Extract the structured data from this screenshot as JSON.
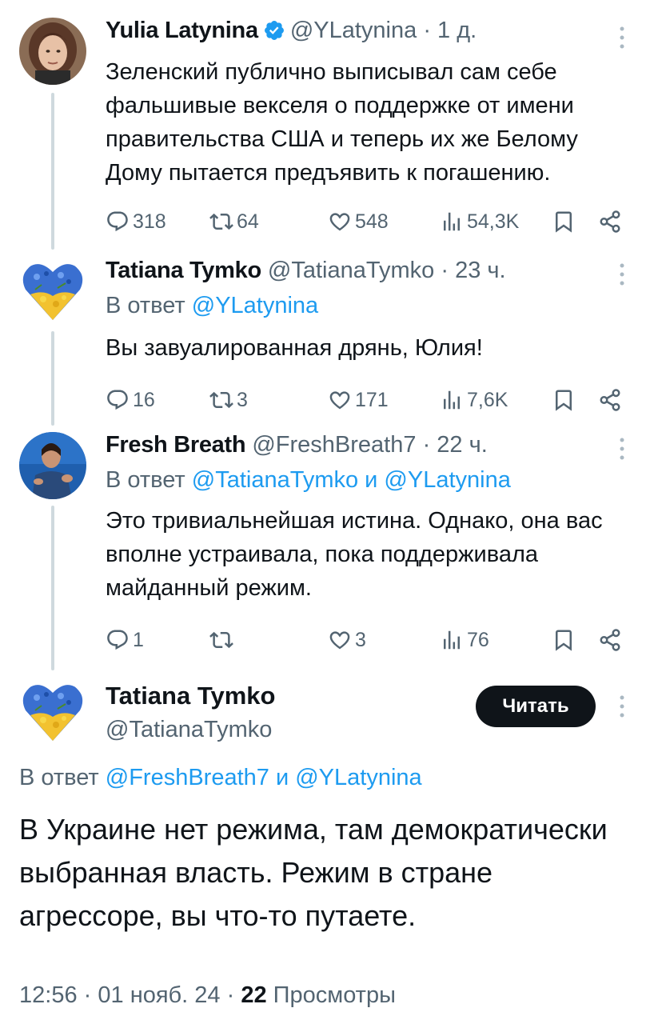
{
  "tweets": [
    {
      "name": "Yulia Latynina",
      "handle": "@YLatynina",
      "time": "1 д.",
      "text": "Зеленский публично выписывал сам себе фальшивые векселя о поддержке от имени правительства США и  теперь их же Белому Дому пытается предъявить к погашению.",
      "replies": "318",
      "retweets": "64",
      "likes": "548",
      "views": "54,3K"
    },
    {
      "name": "Tatiana Tymko",
      "handle": "@TatianaTymko",
      "time": "23 ч.",
      "reply_prefix": "В ответ",
      "reply_mentions": "@YLatynina",
      "text": "Вы завуалированная дрянь, Юлия!",
      "replies": "16",
      "retweets": "3",
      "likes": "171",
      "views": "7,6K"
    },
    {
      "name": "Fresh Breath",
      "handle": "@FreshBreath7",
      "time": "22 ч.",
      "reply_prefix": "В ответ",
      "reply_mentions": "@TatianaTymko и @YLatynina",
      "text": "Это тривиальнейшая истина. Однако, она вас вполне устраивала, пока поддерживала майданный режим.",
      "replies": "1",
      "retweets": "",
      "likes": "3",
      "views": "76"
    }
  ],
  "main": {
    "name": "Tatiana Tymko",
    "handle": "@TatianaTymko",
    "follow_label": "Читать",
    "reply_prefix": "В ответ",
    "reply_mentions": "@FreshBreath7 и @YLatynina",
    "text": "В Украине нет режима, там демократически выбранная власть. Режим в стране агрессоре, вы что-то путаете.",
    "time": "12:56",
    "date": "01 нояб. 24",
    "views_count": "22",
    "views_label": "Просмотры"
  },
  "dot": "·",
  "colors": {
    "link": "#1d9bf0",
    "secondary": "#536471",
    "thread_line": "#cfd9de",
    "verified": "#1d9bf0"
  },
  "icons": [
    "reply-icon",
    "retweet-icon",
    "like-icon",
    "views-icon",
    "bookmark-icon",
    "share-icon",
    "more-icon",
    "verified-icon"
  ]
}
